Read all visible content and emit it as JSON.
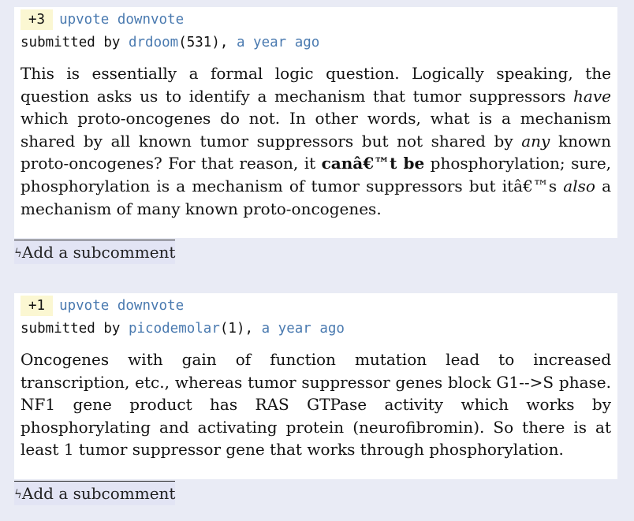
{
  "comments": [
    {
      "score": "+3",
      "upvote_label": "upvote",
      "downvote_label": "downvote",
      "submitted_by_label": "submitted by",
      "username": "drdoom",
      "karma": "(531),",
      "time": "a year ago",
      "text": {
        "p1": "This is essentially a formal logic question. Logically speaking, the question asks us to identify a mechanism that tumor suppressors ",
        "e1": "have",
        "p2": " which proto-oncogenes do not. In other words, what is a mechanism shared by all known tumor suppressors but not shared by ",
        "e2": "any",
        "p3": " known proto-oncogenes? For that reason, it ",
        "b1": "canâ€™t be",
        "p4": " phosphorylation; sure, phosphorylation is a mechanism of tumor suppressors but itâ€™s ",
        "e3": "also",
        "p5": " a mechanism of many known proto-oncogenes."
      },
      "subcomment_label": "Add a subcomment"
    },
    {
      "score": "+1",
      "upvote_label": "upvote",
      "downvote_label": "downvote",
      "submitted_by_label": "submitted by",
      "username": "picodemolar",
      "karma": "(1),",
      "time": "a year ago",
      "text": "Oncogenes with gain of function mutation lead to increased transcription, etc., whereas tumor suppressor genes block G1-->S phase. NF1 gene product has RAS GTPase activity which works by phosphorylating and activating protein (neurofibromin). So there is at least 1 tumor suppressor gene that works through phosphorylation.",
      "subcomment_label": "Add a subcomment"
    }
  ],
  "icons": {
    "subcomment_icon": "ϟ"
  },
  "colors": {
    "link": "#4a7ab0",
    "score_bg": "#fbf7d2",
    "page_bg": "#e9ebf5",
    "subcomment_bg": "#e2e4f4"
  }
}
